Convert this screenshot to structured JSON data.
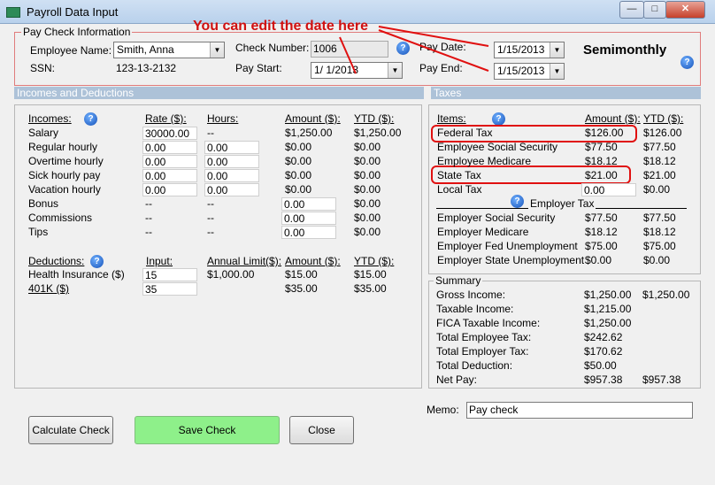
{
  "window": {
    "title": "Payroll Data Input",
    "min": "—",
    "max": "□",
    "close": "✕"
  },
  "paycheck": {
    "legend": "Pay Check Information",
    "employee_label": "Employee Name:",
    "employee_value": "Smith, Anna",
    "ssn_label": "SSN:",
    "ssn_value": "123-13-2132",
    "checknum_label": "Check Number:",
    "checknum_value": "1006",
    "paystart_label": "Pay Start:",
    "paystart_value": "1/  1/2013",
    "paydate_label": "Pay Date:",
    "paydate_value": "1/15/2013",
    "payend_label": "Pay End:",
    "payend_value": "1/15/2013",
    "frequency": "Semimonthly"
  },
  "annotation": "You can edit the date here",
  "incomes": {
    "section_title": "Incomes and Deductions",
    "headers": [
      "Incomes:",
      "Rate ($):",
      "Hours:",
      "Amount ($):",
      "YTD ($):"
    ],
    "rows": [
      [
        "Salary",
        "30000.00",
        "--",
        "$1,250.00",
        "$1,250.00"
      ],
      [
        "Regular hourly",
        "0.00",
        "0.00",
        "$0.00",
        "$0.00"
      ],
      [
        "Overtime hourly",
        "0.00",
        "0.00",
        "$0.00",
        "$0.00"
      ],
      [
        "Sick hourly pay",
        "0.00",
        "0.00",
        "$0.00",
        "$0.00"
      ],
      [
        "Vacation hourly",
        "0.00",
        "0.00",
        "$0.00",
        "$0.00"
      ],
      [
        "Bonus",
        "--",
        "--",
        "0.00",
        "$0.00"
      ],
      [
        "Commissions",
        "--",
        "--",
        "0.00",
        "$0.00"
      ],
      [
        "Tips",
        "--",
        "--",
        "0.00",
        "$0.00"
      ]
    ],
    "ded_headers": [
      "Deductions:",
      "Input:",
      "Annual Limit($):",
      "Amount ($):",
      "YTD ($):"
    ],
    "deductions": [
      [
        "Health Insurance  ($)",
        "15",
        "$1,000.00",
        "$15.00",
        "$15.00"
      ],
      [
        "401K  ($)",
        "35",
        "",
        "$35.00",
        "$35.00"
      ]
    ]
  },
  "taxes": {
    "section_title": "Taxes",
    "headers": [
      "Items:",
      "Amount ($):",
      "YTD ($):"
    ],
    "rows": [
      [
        "Federal Tax",
        "$126.00",
        "$126.00"
      ],
      [
        "Employee Social Security",
        "$77.50",
        "$77.50"
      ],
      [
        "Employee Medicare",
        "$18.12",
        "$18.12"
      ],
      [
        "State Tax",
        "$21.00",
        "$21.00"
      ],
      [
        "Local Tax",
        "0.00",
        "$0.00"
      ]
    ],
    "employer_label": "Employer Tax",
    "employer_rows": [
      [
        "Employer Social Security",
        "$77.50",
        "$77.50"
      ],
      [
        "Employer Medicare",
        "$18.12",
        "$18.12"
      ],
      [
        "Employer Fed Unemployment",
        "$75.00",
        "$75.00"
      ],
      [
        "Employer State Unemployment",
        "$0.00",
        "$0.00"
      ]
    ]
  },
  "summary": {
    "legend": "Summary",
    "rows": [
      [
        "Gross Income:",
        "$1,250.00",
        "$1,250.00"
      ],
      [
        "Taxable Income:",
        "$1,215.00",
        ""
      ],
      [
        "FICA Taxable Income:",
        "$1,250.00",
        ""
      ],
      [
        "Total Employee Tax:",
        "$242.62",
        ""
      ],
      [
        "Total Employer Tax:",
        "$170.62",
        ""
      ],
      [
        "Total Deduction:",
        "$50.00",
        ""
      ],
      [
        "Net Pay:",
        "$957.38",
        "$957.38"
      ]
    ]
  },
  "memo": {
    "label": "Memo:",
    "value": "Pay check"
  },
  "buttons": {
    "calculate": "Calculate Check",
    "save": "Save Check",
    "close": "Close"
  },
  "colors": {
    "accent": "#adc2d8",
    "save": "#8ef08a",
    "highlight": "#e01010"
  }
}
